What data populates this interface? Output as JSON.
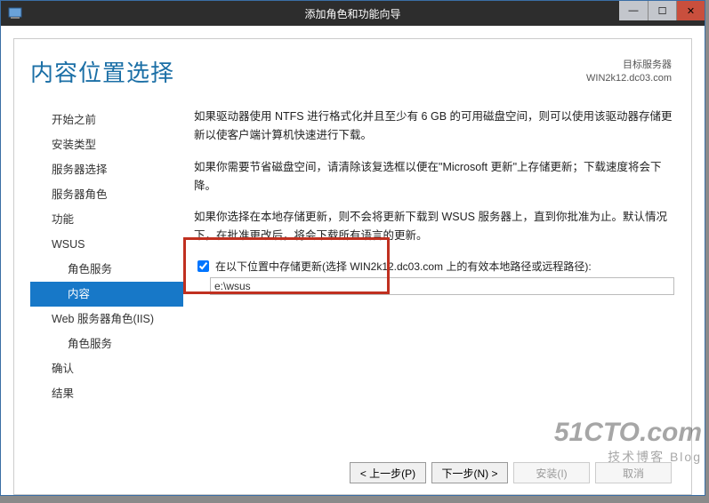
{
  "window": {
    "title": "添加角色和功能向导"
  },
  "header": {
    "page_title": "内容位置选择",
    "server_label": "目标服务器",
    "server_name": "WIN2k12.dc03.com"
  },
  "nav": {
    "items": [
      {
        "label": "开始之前",
        "indent": 0,
        "active": false
      },
      {
        "label": "安装类型",
        "indent": 0,
        "active": false
      },
      {
        "label": "服务器选择",
        "indent": 0,
        "active": false
      },
      {
        "label": "服务器角色",
        "indent": 0,
        "active": false
      },
      {
        "label": "功能",
        "indent": 0,
        "active": false
      },
      {
        "label": "WSUS",
        "indent": 0,
        "active": false
      },
      {
        "label": "角色服务",
        "indent": 1,
        "active": false
      },
      {
        "label": "内容",
        "indent": 1,
        "active": true
      },
      {
        "label": "Web 服务器角色(IIS)",
        "indent": 0,
        "active": false
      },
      {
        "label": "角色服务",
        "indent": 1,
        "active": false
      },
      {
        "label": "确认",
        "indent": 0,
        "active": false
      },
      {
        "label": "结果",
        "indent": 0,
        "active": false
      }
    ]
  },
  "body": {
    "p1": "如果驱动器使用 NTFS 进行格式化并且至少有 6 GB 的可用磁盘空间，则可以使用该驱动器存储更新以使客户端计算机快速进行下载。",
    "p2": "如果你需要节省磁盘空间，请清除该复选框以便在\"Microsoft 更新\"上存储更新；下载速度将会下降。",
    "p3": "如果你选择在本地存储更新，则不会将更新下载到 WSUS 服务器上，直到你批准为止。默认情况下，在批准更改后，将会下载所有语言的更新。",
    "checkbox_label": "在以下位置中存储更新(选择 WIN2k12.dc03.com 上的有效本地路径或远程路径):",
    "path_value": "e:\\wsus"
  },
  "buttons": {
    "prev": "< 上一步(P)",
    "next": "下一步(N) >",
    "install": "安装(I)",
    "cancel": "取消"
  },
  "watermark": {
    "line1": "51CTO.com",
    "line2": "技术博客  Blog"
  }
}
